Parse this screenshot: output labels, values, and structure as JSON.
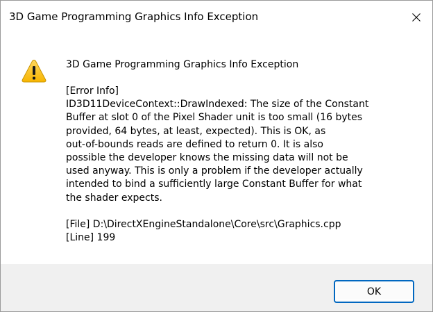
{
  "window": {
    "title": "3D Game Programming Graphics Info Exception",
    "close_icon": "close-icon"
  },
  "message": {
    "icon": "warning-icon",
    "heading": "3D Game Programming Graphics Info Exception",
    "lines": [
      "[Error Info]",
      "ID3D11DeviceContext::DrawIndexed: The size of the Constant",
      "Buffer at slot 0 of the Pixel Shader unit is too small (16 bytes",
      "provided, 64 bytes, at least, expected). This is OK, as",
      "out-of-bounds reads are defined to return 0. It is also",
      "possible the developer knows the missing data will not be",
      "used anyway. This is only a problem if the developer actually",
      "intended to bind a sufficiently large Constant Buffer for what",
      "the shader expects.",
      "",
      "[File] D:\\DirectXEngineStandalone\\Core\\src\\Graphics.cpp",
      "[Line] 199"
    ]
  },
  "buttons": {
    "ok_label": "OK"
  },
  "colors": {
    "accent": "#0067c0",
    "footer_bg": "#f0f0f0",
    "warning_fill": "#ffc83d",
    "warning_outline": "#b38900"
  }
}
